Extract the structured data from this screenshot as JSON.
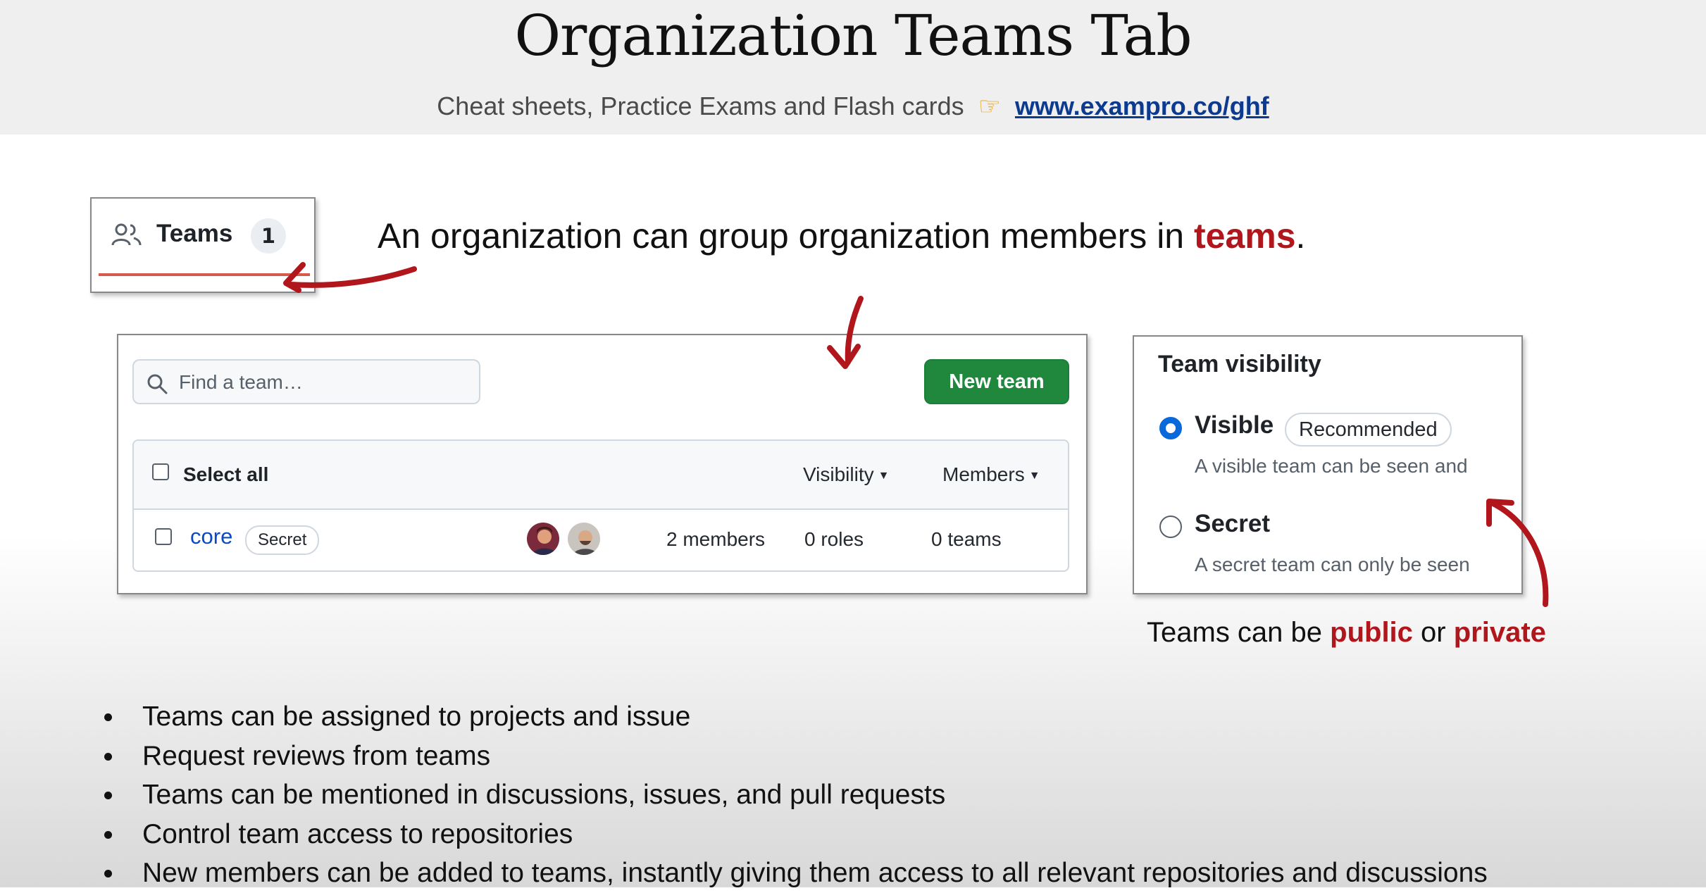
{
  "slide": {
    "title": "Organization Teams Tab",
    "subtitle_text": "Cheat sheets, Practice Exams and Flash cards",
    "subtitle_link": "www.exampro.co/ghf",
    "headline_prefix": "An organization can group organization members in ",
    "headline_accent": "teams",
    "headline_suffix": ".",
    "caption_prefix": "Teams can be ",
    "caption_public": "public",
    "caption_mid": " or ",
    "caption_private": "private",
    "bullets": [
      "Teams can be assigned to projects and issue",
      "Request reviews from teams",
      "Teams can be mentioned in discussions, issues, and pull requests",
      "Control team access to repositories",
      "New members can be added to teams, instantly giving them access to all relevant repositories and discussions"
    ]
  },
  "teams_tab": {
    "label": "Teams",
    "count": "1",
    "icon": "people-icon"
  },
  "team_list": {
    "search_placeholder": "Find a team…",
    "new_team_label": "New team",
    "select_all_label": "Select all",
    "visibility_filter": "Visibility",
    "members_filter": "Members",
    "rows": [
      {
        "name": "core",
        "badge": "Secret",
        "members": "2 members",
        "roles": "0 roles",
        "teams": "0 teams"
      }
    ]
  },
  "visibility": {
    "title": "Team visibility",
    "options": [
      {
        "label": "Visible",
        "badge": "Recommended",
        "description": "A visible team can be seen and",
        "checked": true
      },
      {
        "label": "Secret",
        "description": "A secret team can only be seen",
        "checked": false
      }
    ]
  },
  "colors": {
    "accent_red": "#b0161b",
    "primary_button": "#1f883d",
    "link_blue": "#0a4bbf",
    "radio_checked": "#0969da"
  }
}
